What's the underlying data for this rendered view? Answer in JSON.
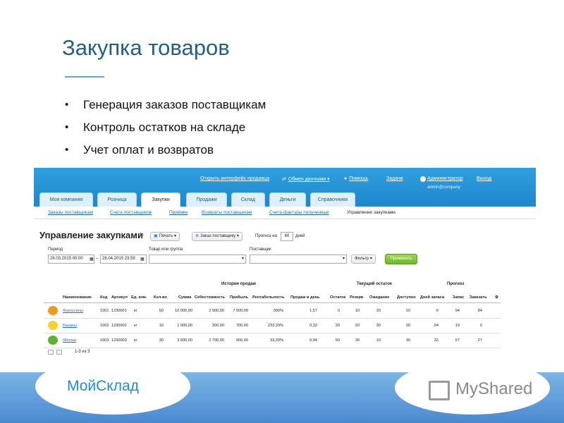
{
  "slide": {
    "title": "Закупка товаров",
    "bullets": [
      "Генерация заказов поставщикам",
      "Контроль остатков на складе",
      "Учет оплат и возвратов"
    ]
  },
  "app": {
    "topnav": {
      "open_sales": "Открыть интерфейс продавца",
      "data_exchange": "Обмен данными",
      "help": "Помощь",
      "tasks": "Задачи",
      "admin": "Администратор",
      "admin_email": "admin@company",
      "logout": "Выход"
    },
    "tabs": [
      "Моя компания",
      "Розница",
      "Закупки",
      "Продажи",
      "Склад",
      "Деньги",
      "Справочники"
    ],
    "active_tab": "Закупки",
    "subnav": [
      "Заказы поставщикам",
      "Счета поставщиков",
      "Приёмки",
      "Возвраты поставщикам",
      "Счета-фактуры полученные",
      "Управление закупками"
    ],
    "page_title": "Управление закупками",
    "toolbar": {
      "print": "Печать",
      "order_supplier": "Заказ поставщику",
      "forecast_label": "Прогноз на",
      "forecast_value": "60",
      "forecast_unit": "дней"
    },
    "filters": {
      "period_label": "Период",
      "date_from": "28.03.2015 00:00",
      "date_sep": "–",
      "date_to": "28.04.2015 23:59",
      "product_label": "Товар или группа",
      "supplier_label": "Поставщик",
      "filter_btn": "Фильтр",
      "apply_btn": "Применить"
    },
    "table": {
      "groups": {
        "history": "История продаж",
        "stock": "Текущий остаток",
        "forecast": "Прогноз"
      },
      "columns": [
        "Наименование",
        "Код",
        "Артикул",
        "Ед. изм.",
        "Кол-во",
        "Сумма",
        "Себестоимость",
        "Прибыль",
        "Рентабельность",
        "Продаж в день",
        "Остаток",
        "Резерв",
        "Ожидание",
        "Доступно",
        "Дней запаса",
        "Запас",
        "Заказать"
      ],
      "rows": [
        {
          "name": "Апельсины",
          "code": "1001",
          "sku": "1230001",
          "unit": "кг",
          "qty": "50",
          "sum": "10 000,00",
          "cost": "2 500,00",
          "profit": "7 500,00",
          "margin": "300%",
          "per_day": "1,57",
          "stock": "0",
          "reserve": "10",
          "waiting": "20",
          "available": "10",
          "days": "6",
          "supply": "94",
          "order": "84",
          "color": "#f29a1f"
        },
        {
          "name": "Бананы",
          "code": "1002",
          "sku": "1230002",
          "unit": "кг",
          "qty": "10",
          "sum": "1 000,00",
          "cost": "300,00",
          "profit": "700,00",
          "margin": "233,33%",
          "per_day": "0,32",
          "stock": "20",
          "reserve": "20",
          "waiting": "30",
          "available": "30",
          "days": "94",
          "supply": "19",
          "order": "0",
          "color": "#f3d22b"
        },
        {
          "name": "Яблоки",
          "code": "1003",
          "sku": "1230003",
          "unit": "кг",
          "qty": "30",
          "sum": "3 600,00",
          "cost": "2 700,00",
          "profit": "900,00",
          "margin": "33,33%",
          "per_day": "0,94",
          "stock": "50",
          "reserve": "30",
          "waiting": "10",
          "available": "30",
          "days": "32",
          "supply": "57",
          "order": "27",
          "color": "#5bb231"
        }
      ],
      "pager": "1-3 из 3"
    }
  },
  "footer": {
    "brand": "МойСклад",
    "watermark": "MyShared"
  },
  "colors": {
    "accent": "#1f87cc",
    "title": "#1f5f8b",
    "footer": "#4a89cf"
  }
}
